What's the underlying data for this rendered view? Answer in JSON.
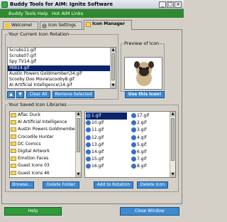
{
  "window": {
    "title": "Buddy Tools for AIM:  Ignite Software",
    "minimize": "_",
    "maximize": "□",
    "close": "×"
  },
  "menu": {
    "items": [
      "Buddy Tools Help",
      "Hot AIM Links"
    ]
  },
  "tabs": [
    {
      "label": "Welcome!",
      "icon": "smiley-icon"
    },
    {
      "label": "Icon Settings",
      "icon": "gear-icon"
    },
    {
      "label": "Icon Manager",
      "icon": "folder-icon",
      "active": true
    }
  ],
  "rotation": {
    "legend": "Your Current Icon Rotation",
    "items": [
      "Scrubs11.gif",
      "Scrubs07.gif",
      "Spy TV14.gif",
      "MIB14.gif",
      "Austin Powers Goldmember\\34.gif",
      "Scooby Doo Movie\\scooby8.gif",
      "AI Artificial Intelligence\\14.gif"
    ],
    "selected_index": 3,
    "clear_all": "Clear All",
    "remove_selected": "Remove Selected",
    "use_icon": "Use this Icon!"
  },
  "preview": {
    "legend": "Preview of Icon"
  },
  "libraries": {
    "legend": "Your Saved Icon Libraries",
    "folders": [
      "Aflac Duck",
      "AI Artificial Intelligence",
      "Austin Powers Goldmember",
      "Crocodile Hunter",
      "DC Comics",
      "Digital Artwork",
      "Emotion Faces",
      "Guest Icons 03",
      "Guest Icons 46"
    ],
    "files_col1": [
      "1.gif",
      "10.gif",
      "11.gif",
      "12.gif",
      "13.gif",
      "14.gif",
      "15.gif",
      "16.gif"
    ],
    "files_col2": [
      "17.gif",
      "2.gif",
      "3.gif",
      "4.gif",
      "5.gif",
      "6.gif",
      "7.gif",
      "8.gif"
    ],
    "selected_file": "1.gif",
    "browse": "Browse...",
    "delete_folder": "Delete Folder",
    "add_to_rotation": "Add to Rotation",
    "delete_icon": "Delete Icon"
  },
  "footer": {
    "help": "Help",
    "close": "Close Window"
  },
  "colors": {
    "accent_green": "#2f8a2f",
    "button_blue": "#3c8bd3",
    "selection": "#0a246a"
  }
}
